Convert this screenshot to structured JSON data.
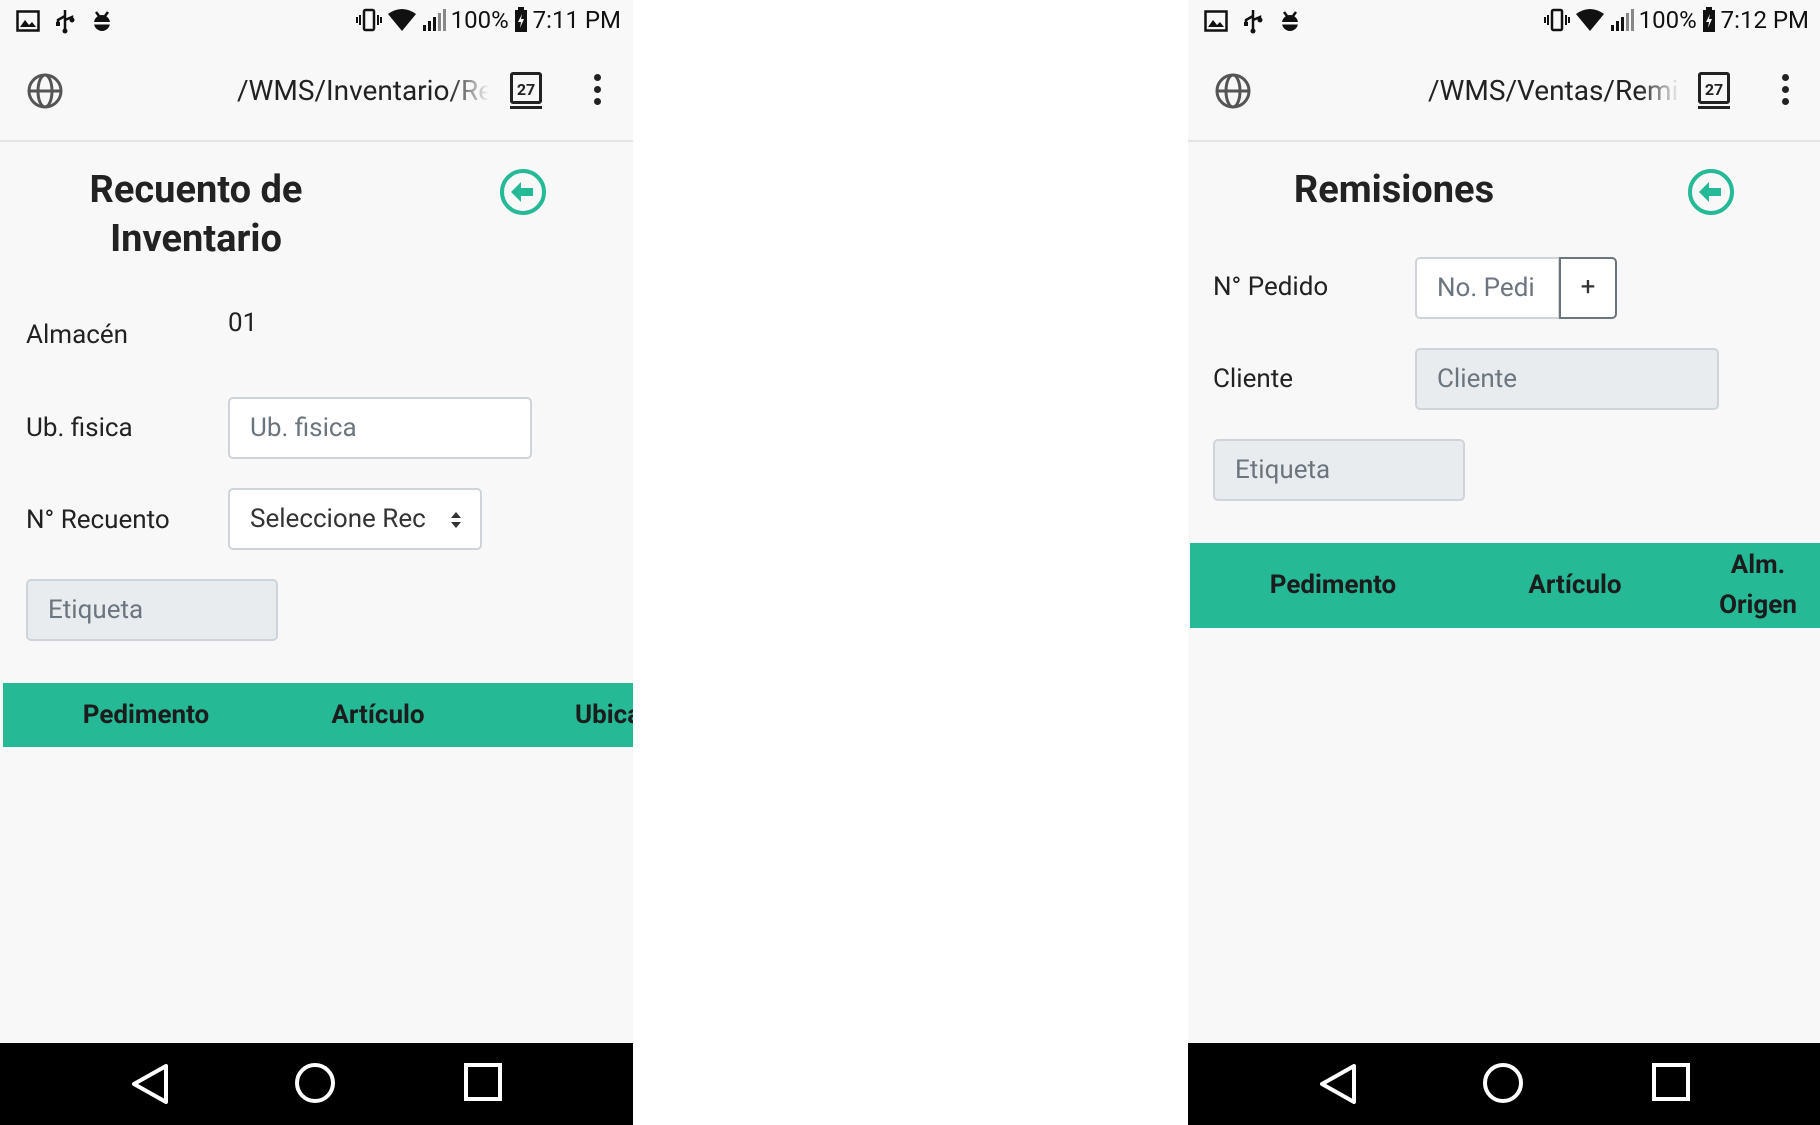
{
  "left": {
    "status": {
      "battery": "100%",
      "time": "7:11 PM"
    },
    "browser": {
      "url": "/WMS/Inventario/Re",
      "tab_count": "27"
    },
    "title_line1": "Recuento de",
    "title_line2": "Inventario",
    "form": {
      "almacen_label": "Almacén",
      "almacen_value": "01",
      "ubfisica_label": "Ub. fisica",
      "ubfisica_placeholder": "Ub. fisica",
      "recuento_label": "N° Recuento",
      "recuento_selected": "Seleccione Rec",
      "etiqueta_placeholder": "Etiqueta"
    },
    "table": {
      "headers": [
        "Pedimento",
        "Artículo",
        "Ubica"
      ]
    }
  },
  "right": {
    "status": {
      "battery": "100%",
      "time": "7:12 PM"
    },
    "browser": {
      "url": "/WMS/Ventas/Remi",
      "tab_count": "27"
    },
    "title": "Remisiones",
    "form": {
      "pedido_label": "N° Pedido",
      "pedido_placeholder": "No. Pedi",
      "add_label": "+",
      "cliente_label": "Cliente",
      "cliente_placeholder": "Cliente",
      "etiqueta_placeholder": "Etiqueta"
    },
    "table": {
      "headers": [
        "Pedimento",
        "Artículo",
        "Alm.",
        "Origen"
      ]
    }
  },
  "colors": {
    "accent": "#26b995",
    "background": "#f8f8f8",
    "navbar": "#000000"
  }
}
